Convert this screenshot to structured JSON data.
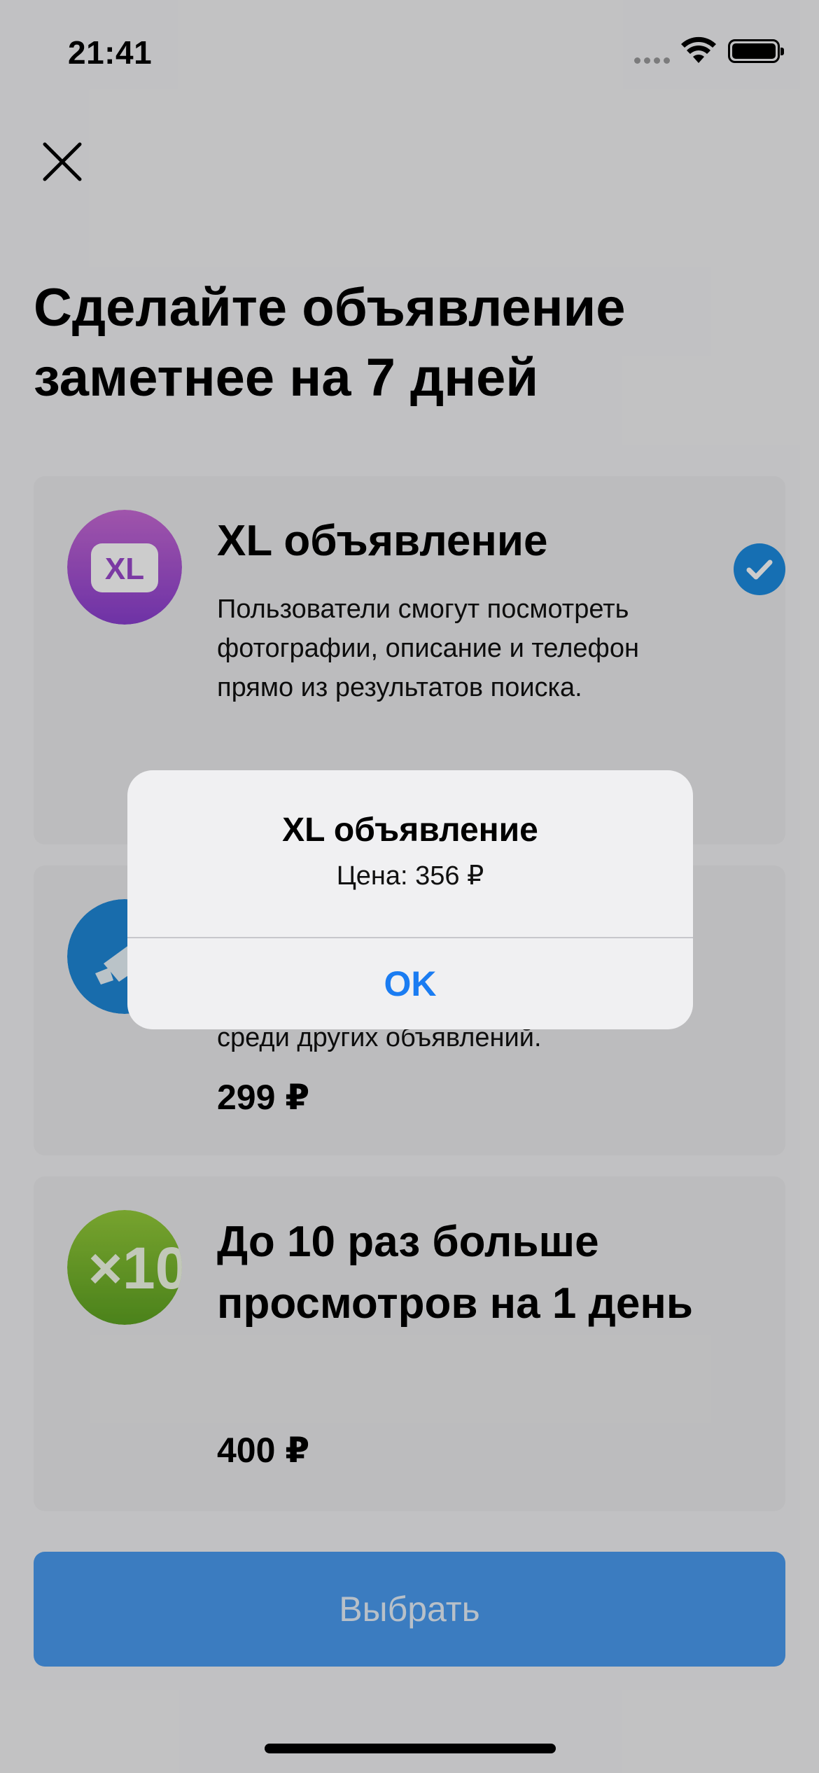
{
  "status_bar": {
    "time": "21:41"
  },
  "header": {
    "title_line1": "Сделайте объявление",
    "title_line2": "заметнее на 7 дней"
  },
  "options": [
    {
      "title": "XL объявление",
      "description": "Пользователи смогут посмотреть фотографии, описание и телефон прямо из результатов поиска.",
      "icon": "xl-icon",
      "icon_text": "XL",
      "selected": true
    },
    {
      "title": "",
      "description_visible_fragment": "среди других объявлений.",
      "price": "299 ₽",
      "icon": "highlight-icon",
      "selected": false
    },
    {
      "title": "До 10 раз больше просмотров на 1 день",
      "price": "400 ₽",
      "icon": "x10-icon",
      "icon_text": "×10",
      "selected": false
    }
  ],
  "select_button": "Выбрать",
  "alert": {
    "title": "XL объявление",
    "message": "Цена: 356 ₽",
    "ok_label": "OK"
  },
  "colors": {
    "accent": "#1a7cf2",
    "select_button": "#4a9cf0",
    "check": "#1c8be0",
    "xl_icon": "#a24fcf",
    "x10_icon": "#7bb82e",
    "highlight_icon": "#1e88d8"
  }
}
